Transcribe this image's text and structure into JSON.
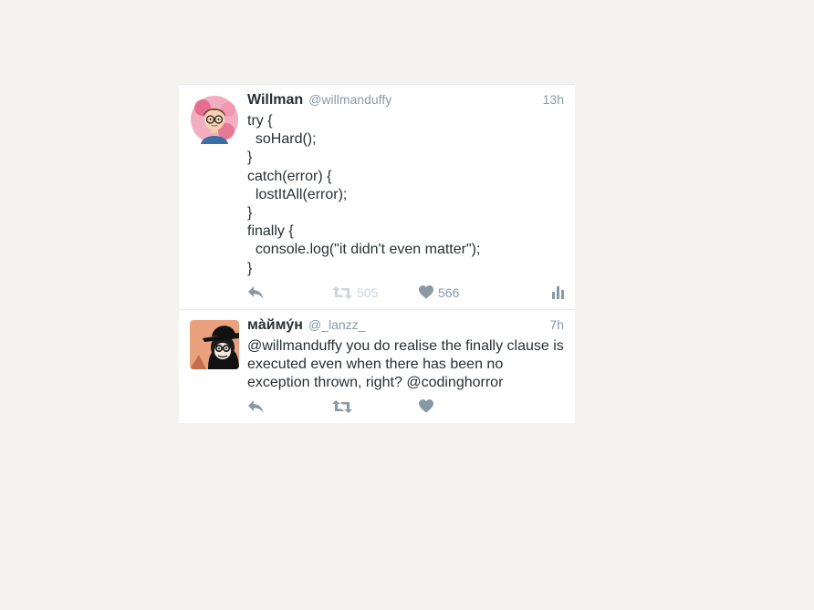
{
  "tweets": [
    {
      "name": "Willman",
      "handle": "@willmanduffy",
      "time": "13h",
      "text": "try {\n  soHard();\n}\ncatch(error) {\n  lostItAll(error);\n}\nfinally {\n  console.log(\"it didn't even matter\");\n}",
      "retweets": "505",
      "likes": "566",
      "avatar_icon": "cartoon-glasses-avatar"
    },
    {
      "name": "мàймýн",
      "handle": "@_lanzz_",
      "time": "7h",
      "text": "@willmanduffy you do realise the finally clause is executed even when there has been no exception thrown, right? @codinghorror",
      "avatar_icon": "monkey-hat-avatar"
    }
  ],
  "colors": {
    "background": "#f4f3f0",
    "card": "#ffffff",
    "text": "#292f33",
    "muted": "#8899a6",
    "faint": "#ccd6dd"
  }
}
